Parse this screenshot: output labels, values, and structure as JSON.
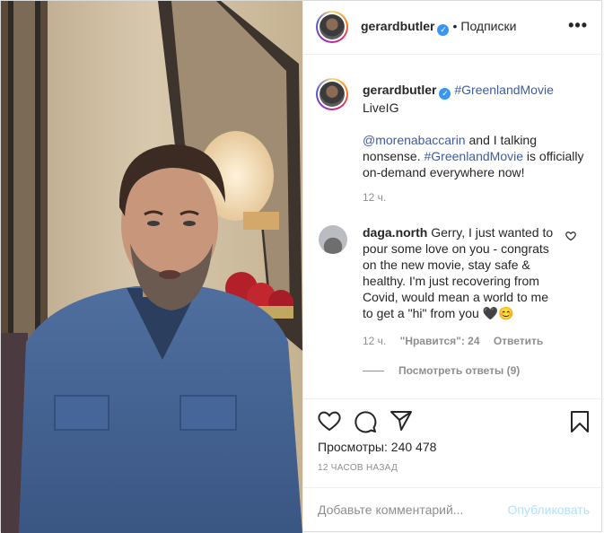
{
  "header": {
    "username": "gerardbutler",
    "separator": "•",
    "follow_label": "Подписки",
    "more_label": "•••"
  },
  "caption": {
    "username": "gerardbutler",
    "hashtag": "#GreenlandMovie",
    "line2": "LiveIG",
    "mention": "@morenabaccarin",
    "text_after_mention": " and I talking nonsense. ",
    "hashtag2": "#GreenlandMovie",
    "text_end": " is officially on-demand everywhere now!",
    "time": "12 ч."
  },
  "comment": {
    "username": "daga.north",
    "text": "Gerry, I just wanted to pour some love on you - congrats on the new movie, stay safe & healthy. I'm just recovering from Covid, would mean a world to me to get a \"hi\" from you 🖤😊",
    "time": "12 ч.",
    "likes": "\"Нравится\": 24",
    "reply_label": "Ответить",
    "view_replies": "Посмотреть ответы (9)"
  },
  "stats": {
    "views_label": "Просмотры:",
    "views_count": "240 478",
    "time_ago": "12 ЧАСОВ НАЗАД"
  },
  "add_comment": {
    "placeholder": "Добавьте комментарий...",
    "publish_label": "Опубликовать"
  },
  "icons": {
    "verified": "verified-badge-icon",
    "like": "heart-icon",
    "comment": "comment-bubble-icon",
    "share": "paper-plane-icon",
    "save": "bookmark-icon"
  },
  "colors": {
    "link": "#385185",
    "muted": "#8e8e8e",
    "verified": "#3897f0",
    "publish_disabled": "#b2dffc"
  }
}
